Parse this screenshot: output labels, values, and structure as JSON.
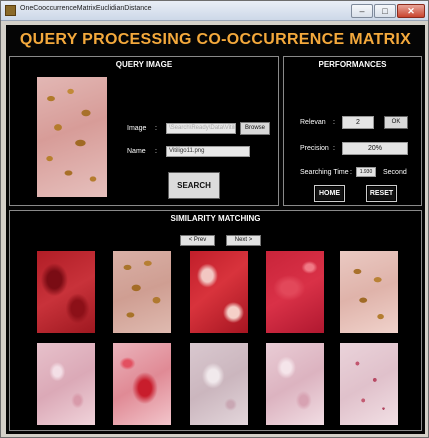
{
  "window": {
    "title": "OneCooccurrenceMatrixEuclidianDistance",
    "minimize_glyph": "–",
    "maximize_glyph": "□",
    "close_glyph": "✕"
  },
  "header": {
    "title": "QUERY PROCESSING CO-OCCURRENCE MATRIX"
  },
  "query": {
    "title": "QUERY IMAGE",
    "image_label": "Image",
    "image_path": "\\Search\\Ready\\Data\\Vitili",
    "browse_label": "Browse",
    "name_label": "Name",
    "name_value": "Vitiligo11.png",
    "colon": ":",
    "search_label": "SEARCH"
  },
  "performances": {
    "title": "PERFORMANCES",
    "relevan_label": "Relevan",
    "relevan_value": "2",
    "ok_label": "OK",
    "precision_label": "Precision",
    "precision_value": "20%",
    "searching_time_label": "Searching Time",
    "searching_time_value": "1.930",
    "searching_time_unit": "Second",
    "colon": ":",
    "home_label": "HOME",
    "reset_label": "RESET"
  },
  "similarity": {
    "title": "SIMILARITY MATCHING",
    "prev_label": "< Prev",
    "next_label": "Next >"
  },
  "colors": {
    "title_accent": "#f4a93c",
    "frame_background": "#050505"
  }
}
